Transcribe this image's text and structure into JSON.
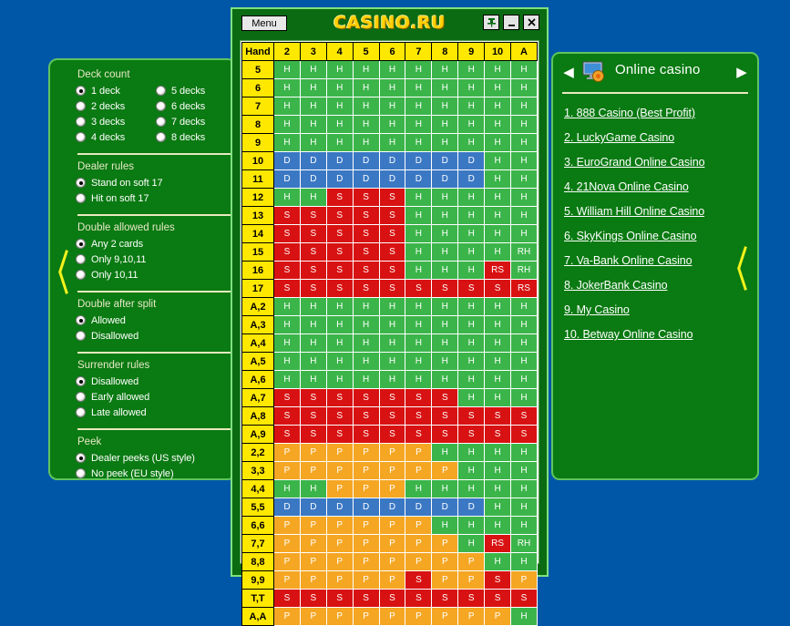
{
  "window": {
    "title": "CASINO.RU",
    "menu_label": "Menu",
    "buttons": [
      {
        "name": "pin",
        "label": "pin-icon"
      },
      {
        "name": "minimize",
        "label": "minimize-icon"
      },
      {
        "name": "close",
        "label": "close-icon"
      }
    ]
  },
  "settings": {
    "groups": [
      {
        "title": "Deck count",
        "layout": "two-column",
        "options": [
          {
            "label": "1 deck",
            "selected": true
          },
          {
            "label": "5 decks",
            "selected": false
          },
          {
            "label": "2 decks",
            "selected": false
          },
          {
            "label": "6 decks",
            "selected": false
          },
          {
            "label": "3 decks",
            "selected": false
          },
          {
            "label": "7 decks",
            "selected": false
          },
          {
            "label": "4 decks",
            "selected": false
          },
          {
            "label": "8 decks",
            "selected": false
          }
        ]
      },
      {
        "title": "Dealer rules",
        "layout": "one-column",
        "options": [
          {
            "label": "Stand on soft 17",
            "selected": true
          },
          {
            "label": "Hit on soft 17",
            "selected": false
          }
        ]
      },
      {
        "title": "Double allowed rules",
        "layout": "one-column",
        "options": [
          {
            "label": "Any 2 cards",
            "selected": true
          },
          {
            "label": "Only 9,10,11",
            "selected": false
          },
          {
            "label": "Only 10,11",
            "selected": false
          }
        ]
      },
      {
        "title": "Double after split",
        "layout": "one-column",
        "options": [
          {
            "label": "Allowed",
            "selected": true
          },
          {
            "label": "Disallowed",
            "selected": false
          }
        ]
      },
      {
        "title": "Surrender rules",
        "layout": "one-column",
        "options": [
          {
            "label": "Disallowed",
            "selected": true
          },
          {
            "label": "Early allowed",
            "selected": false
          },
          {
            "label": "Late allowed",
            "selected": false
          }
        ]
      },
      {
        "title": "Peek",
        "layout": "one-column",
        "options": [
          {
            "label": "Dealer peeks (US style)",
            "selected": true
          },
          {
            "label": "No peek (EU style)",
            "selected": false
          }
        ]
      }
    ]
  },
  "strategy_table": {
    "corner_header": "Hand",
    "dealer_cards": [
      "2",
      "3",
      "4",
      "5",
      "6",
      "7",
      "8",
      "9",
      "10",
      "A"
    ],
    "rows": [
      {
        "hand": "5",
        "cells": [
          "H",
          "H",
          "H",
          "H",
          "H",
          "H",
          "H",
          "H",
          "H",
          "H"
        ]
      },
      {
        "hand": "6",
        "cells": [
          "H",
          "H",
          "H",
          "H",
          "H",
          "H",
          "H",
          "H",
          "H",
          "H"
        ]
      },
      {
        "hand": "7",
        "cells": [
          "H",
          "H",
          "H",
          "H",
          "H",
          "H",
          "H",
          "H",
          "H",
          "H"
        ]
      },
      {
        "hand": "8",
        "cells": [
          "H",
          "H",
          "H",
          "H",
          "H",
          "H",
          "H",
          "H",
          "H",
          "H"
        ]
      },
      {
        "hand": "9",
        "cells": [
          "H",
          "H",
          "H",
          "H",
          "H",
          "H",
          "H",
          "H",
          "H",
          "H"
        ]
      },
      {
        "hand": "10",
        "cells": [
          "D",
          "D",
          "D",
          "D",
          "D",
          "D",
          "D",
          "D",
          "H",
          "H"
        ]
      },
      {
        "hand": "11",
        "cells": [
          "D",
          "D",
          "D",
          "D",
          "D",
          "D",
          "D",
          "D",
          "H",
          "H"
        ]
      },
      {
        "hand": "12",
        "cells": [
          "H",
          "H",
          "S",
          "S",
          "S",
          "H",
          "H",
          "H",
          "H",
          "H"
        ]
      },
      {
        "hand": "13",
        "cells": [
          "S",
          "S",
          "S",
          "S",
          "S",
          "H",
          "H",
          "H",
          "H",
          "H"
        ]
      },
      {
        "hand": "14",
        "cells": [
          "S",
          "S",
          "S",
          "S",
          "S",
          "H",
          "H",
          "H",
          "H",
          "H"
        ]
      },
      {
        "hand": "15",
        "cells": [
          "S",
          "S",
          "S",
          "S",
          "S",
          "H",
          "H",
          "H",
          "H",
          "RH"
        ]
      },
      {
        "hand": "16",
        "cells": [
          "S",
          "S",
          "S",
          "S",
          "S",
          "H",
          "H",
          "H",
          "RS",
          "RH"
        ]
      },
      {
        "hand": "17",
        "cells": [
          "S",
          "S",
          "S",
          "S",
          "S",
          "S",
          "S",
          "S",
          "S",
          "RS"
        ]
      },
      {
        "hand": "A,2",
        "cells": [
          "H",
          "H",
          "H",
          "H",
          "H",
          "H",
          "H",
          "H",
          "H",
          "H"
        ]
      },
      {
        "hand": "A,3",
        "cells": [
          "H",
          "H",
          "H",
          "H",
          "H",
          "H",
          "H",
          "H",
          "H",
          "H"
        ]
      },
      {
        "hand": "A,4",
        "cells": [
          "H",
          "H",
          "H",
          "H",
          "H",
          "H",
          "H",
          "H",
          "H",
          "H"
        ]
      },
      {
        "hand": "A,5",
        "cells": [
          "H",
          "H",
          "H",
          "H",
          "H",
          "H",
          "H",
          "H",
          "H",
          "H"
        ]
      },
      {
        "hand": "A,6",
        "cells": [
          "H",
          "H",
          "H",
          "H",
          "H",
          "H",
          "H",
          "H",
          "H",
          "H"
        ]
      },
      {
        "hand": "A,7",
        "cells": [
          "S",
          "S",
          "S",
          "S",
          "S",
          "S",
          "S",
          "H",
          "H",
          "H"
        ]
      },
      {
        "hand": "A,8",
        "cells": [
          "S",
          "S",
          "S",
          "S",
          "S",
          "S",
          "S",
          "S",
          "S",
          "S"
        ]
      },
      {
        "hand": "A,9",
        "cells": [
          "S",
          "S",
          "S",
          "S",
          "S",
          "S",
          "S",
          "S",
          "S",
          "S"
        ]
      },
      {
        "hand": "2,2",
        "cells": [
          "P",
          "P",
          "P",
          "P",
          "P",
          "P",
          "H",
          "H",
          "H",
          "H"
        ]
      },
      {
        "hand": "3,3",
        "cells": [
          "P",
          "P",
          "P",
          "P",
          "P",
          "P",
          "P",
          "H",
          "H",
          "H"
        ]
      },
      {
        "hand": "4,4",
        "cells": [
          "H",
          "H",
          "P",
          "P",
          "P",
          "H",
          "H",
          "H",
          "H",
          "H"
        ]
      },
      {
        "hand": "5,5",
        "cells": [
          "D",
          "D",
          "D",
          "D",
          "D",
          "D",
          "D",
          "D",
          "H",
          "H"
        ]
      },
      {
        "hand": "6,6",
        "cells": [
          "P",
          "P",
          "P",
          "P",
          "P",
          "P",
          "H",
          "H",
          "H",
          "H"
        ]
      },
      {
        "hand": "7,7",
        "cells": [
          "P",
          "P",
          "P",
          "P",
          "P",
          "P",
          "P",
          "H",
          "RS",
          "RH"
        ]
      },
      {
        "hand": "8,8",
        "cells": [
          "P",
          "P",
          "P",
          "P",
          "P",
          "P",
          "P",
          "P",
          "H",
          "H"
        ]
      },
      {
        "hand": "9,9",
        "cells": [
          "P",
          "P",
          "P",
          "P",
          "P",
          "S",
          "P",
          "P",
          "S",
          "P"
        ]
      },
      {
        "hand": "T,T",
        "cells": [
          "S",
          "S",
          "S",
          "S",
          "S",
          "S",
          "S",
          "S",
          "S",
          "S"
        ]
      },
      {
        "hand": "A,A",
        "cells": [
          "P",
          "P",
          "P",
          "P",
          "P",
          "P",
          "P",
          "P",
          "P",
          "H"
        ]
      }
    ],
    "legend_colors": {
      "hit": "#3bb54a",
      "stand": "#d81212",
      "double": "#3b78c4",
      "split": "#f5a623",
      "header": "#ffe800"
    }
  },
  "casino_panel": {
    "title": "Online casino",
    "prev_label": "◀",
    "next_label": "▶",
    "links": [
      "1.  888 Casino (Best Profit)",
      "2.  LuckyGame Casino",
      "3.  EuroGrand Online Casino",
      "4.  21Nova Online Casino",
      "5.  William Hill Online Casino",
      "6.  SkyKings Online Casino",
      "7.  Va-Bank Online Casino",
      "8.  JokerBank Casino",
      "9.  My Casino",
      "10.  Betway Online Casino"
    ]
  },
  "theme": {
    "desktop_bg": "#0057a8",
    "panel_bg": "#0a7a12",
    "panel_border": "#5fc45f",
    "arrow_color": "#f2f21c",
    "logo_color": "#ffd000"
  }
}
